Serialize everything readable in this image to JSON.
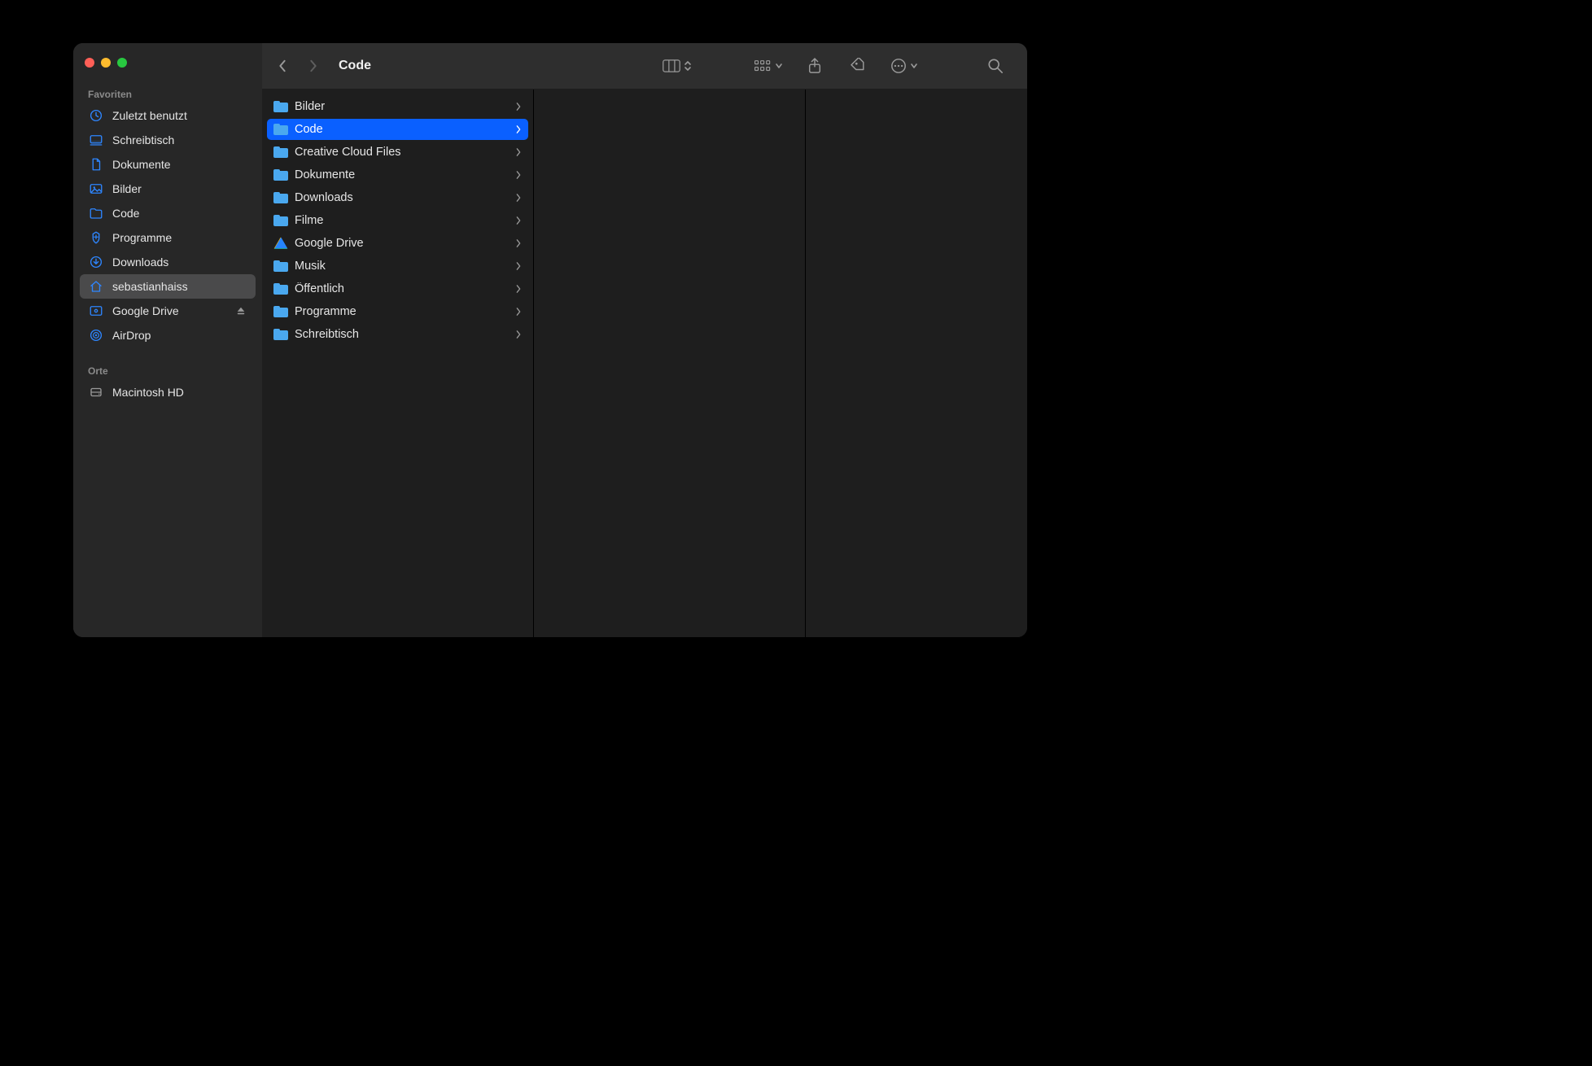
{
  "window": {
    "title": "Code"
  },
  "sidebar": {
    "sections": [
      {
        "heading": "Favoriten",
        "items": [
          {
            "label": "Zuletzt benutzt",
            "icon": "clock",
            "active": false
          },
          {
            "label": "Schreibtisch",
            "icon": "desktop",
            "active": false
          },
          {
            "label": "Dokumente",
            "icon": "document",
            "active": false
          },
          {
            "label": "Bilder",
            "icon": "images",
            "active": false
          },
          {
            "label": "Code",
            "icon": "folder",
            "active": false
          },
          {
            "label": "Programme",
            "icon": "apps",
            "active": false
          },
          {
            "label": "Downloads",
            "icon": "download",
            "active": false
          },
          {
            "label": "sebastianhaiss",
            "icon": "home",
            "active": true
          },
          {
            "label": "Google Drive",
            "icon": "drive",
            "active": false,
            "eject": true
          },
          {
            "label": "AirDrop",
            "icon": "airdrop",
            "active": false
          }
        ]
      },
      {
        "heading": "Orte",
        "items": [
          {
            "label": "Macintosh HD",
            "icon": "disk",
            "active": false,
            "mono": true
          }
        ]
      }
    ]
  },
  "column": {
    "items": [
      {
        "label": "Bilder",
        "icon": "folder",
        "selected": false
      },
      {
        "label": "Code",
        "icon": "folder",
        "selected": true
      },
      {
        "label": "Creative Cloud Files",
        "icon": "folder",
        "selected": false
      },
      {
        "label": "Dokumente",
        "icon": "folder",
        "selected": false
      },
      {
        "label": "Downloads",
        "icon": "folder",
        "selected": false
      },
      {
        "label": "Filme",
        "icon": "folder",
        "selected": false
      },
      {
        "label": "Google Drive",
        "icon": "gdrive",
        "selected": false
      },
      {
        "label": "Musik",
        "icon": "folder",
        "selected": false
      },
      {
        "label": "Öffentlich",
        "icon": "folder",
        "selected": false
      },
      {
        "label": "Programme",
        "icon": "folder",
        "selected": false
      },
      {
        "label": "Schreibtisch",
        "icon": "folder",
        "selected": false
      }
    ]
  }
}
